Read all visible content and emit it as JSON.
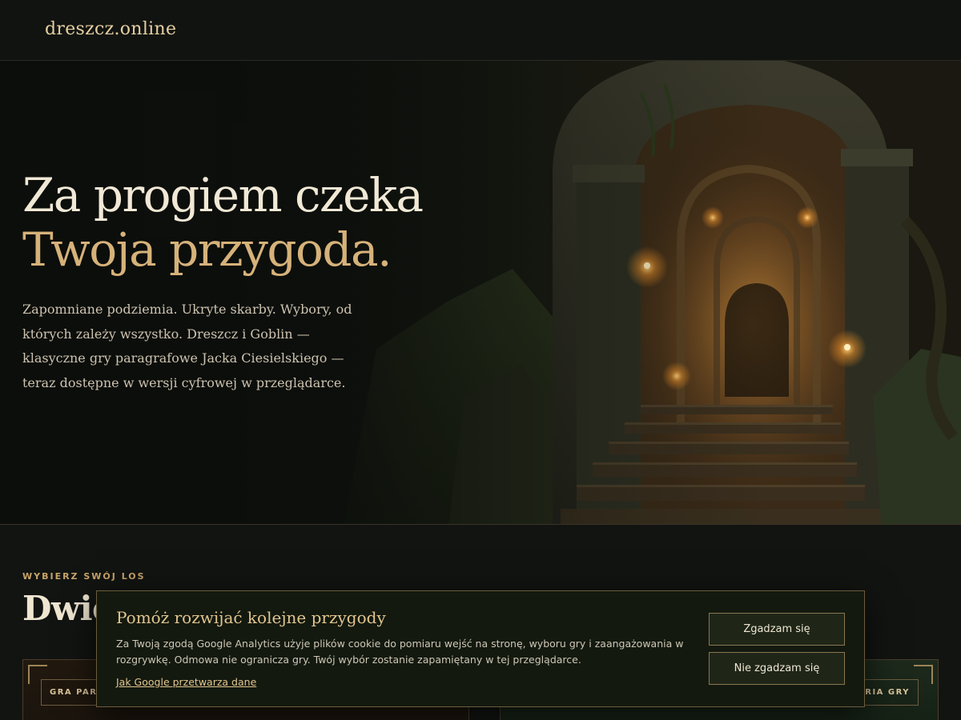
{
  "header": {
    "brand": "dreszcz.online"
  },
  "hero": {
    "title_line1": "Za progiem czeka",
    "title_line2": "Twoja przygoda.",
    "text": "Zapomniane podziemia. Ukryte skarby. Wybory, od których zależy wszystko. Dreszcz i Goblin — klasyczne gry paragrafowe Jacka Ciesielskiego — teraz dostępne w wersji cyfrowej w przeglądarce."
  },
  "section": {
    "eyebrow": "WYBIERZ SWÓJ LOS",
    "title": "Dwie"
  },
  "cards": {
    "left_tag": "GRA PARA",
    "right_tag": "TORIA GRY"
  },
  "cookie": {
    "title": "Pomóż rozwijać kolejne przygody",
    "text": "Za Twoją zgodą Google Analytics użyje plików cookie do pomiaru wejść na stronę, wyboru gry i zaangażowania w rozgrywkę. Odmowa nie ogranicza gry. Twój wybór zostanie zapamiętany w tej przeglądarce.",
    "link": "Jak Google przetwarza dane",
    "accept": "Zgadzam się",
    "decline": "Nie zgadzam się"
  }
}
